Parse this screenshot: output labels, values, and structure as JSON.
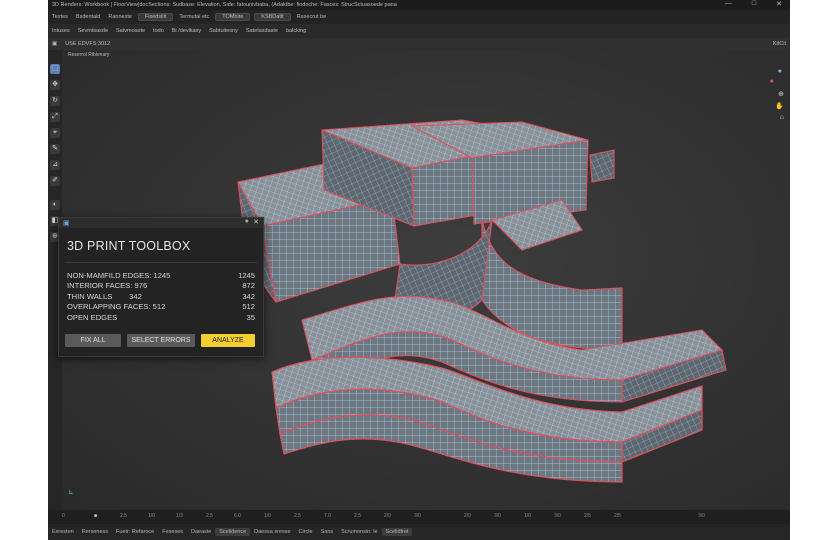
{
  "titlebar": {
    "text": "3D Renders: Workbook | FloorView|docSections: Sudbase: Elevation, Side: fatounivbaba, (Adaktbe: fiodoche: Fasces: StrucSctuasoede pana",
    "controls": [
      "—",
      "□",
      "✕"
    ]
  },
  "menubar": {
    "items": [
      "Textes",
      "Bsdentald",
      "Ranneste",
      "Fixedsilit",
      "Termutal etc",
      "TOMbite",
      "KSBDatlt",
      "Resecrut be"
    ]
  },
  "toolbar": {
    "items": [
      "Intuses",
      "Sevmtsasde",
      "Satvmoaste",
      "todo",
      "Bi /devikasy",
      "Sabtuitesny",
      "Satetasdaste",
      "balcking"
    ]
  },
  "viewport": {
    "label": "USE EDVFS:3012",
    "sublabel": "Reserrol Riblenary",
    "header_right": "KitCit"
  },
  "panel": {
    "title": "3D PRINT TOOLBOX",
    "rows": [
      {
        "label": "NON-MAMFILD EDGES: 1245",
        "value": "1245"
      },
      {
        "label": "INTERIOR FACES: 976",
        "value": "872"
      },
      {
        "label": "THIN WALLS        342",
        "value": "342"
      },
      {
        "label": "OVERLAPPING FACES: 512",
        "value": "512"
      },
      {
        "label": "OPEN EDGES",
        "value": "35"
      }
    ],
    "buttons": {
      "fix_all": "FIX ALL",
      "select_errors": "SELECT ERRORS",
      "analyze": "ANALYZE"
    }
  },
  "timeline": {
    "ticks": [
      "0",
      "2.5",
      "1/0",
      "1/3",
      "2.5",
      "6.0",
      "1/0",
      "2.5",
      "7.0",
      "2.5",
      "2/0",
      "3/0",
      "2/0",
      "3/0",
      "1/0",
      "3/0",
      "2/5",
      "2/5",
      "3/0"
    ]
  },
  "statusbar": {
    "items": [
      "Exresten",
      "Rerseness",
      "Fuetr: Refaroce",
      "Feseses",
      "Daeasie",
      "Scelidence",
      "Daessa sresse",
      "Circle",
      "Sans",
      "Scrumonsin: le",
      "Scelidtret"
    ]
  },
  "colors": {
    "accent": "#f2cf2f",
    "mesh_blue": "#a9d3f2",
    "mesh_red": "#e0505e",
    "background": "#2b2b2b"
  },
  "icons": [
    "select-icon",
    "move-icon",
    "rotate-icon",
    "scale-icon",
    "cursor-icon",
    "brush-icon",
    "measure-icon",
    "annotate-icon",
    "shading-icon",
    "camera-icon",
    "gizmo-icon"
  ]
}
